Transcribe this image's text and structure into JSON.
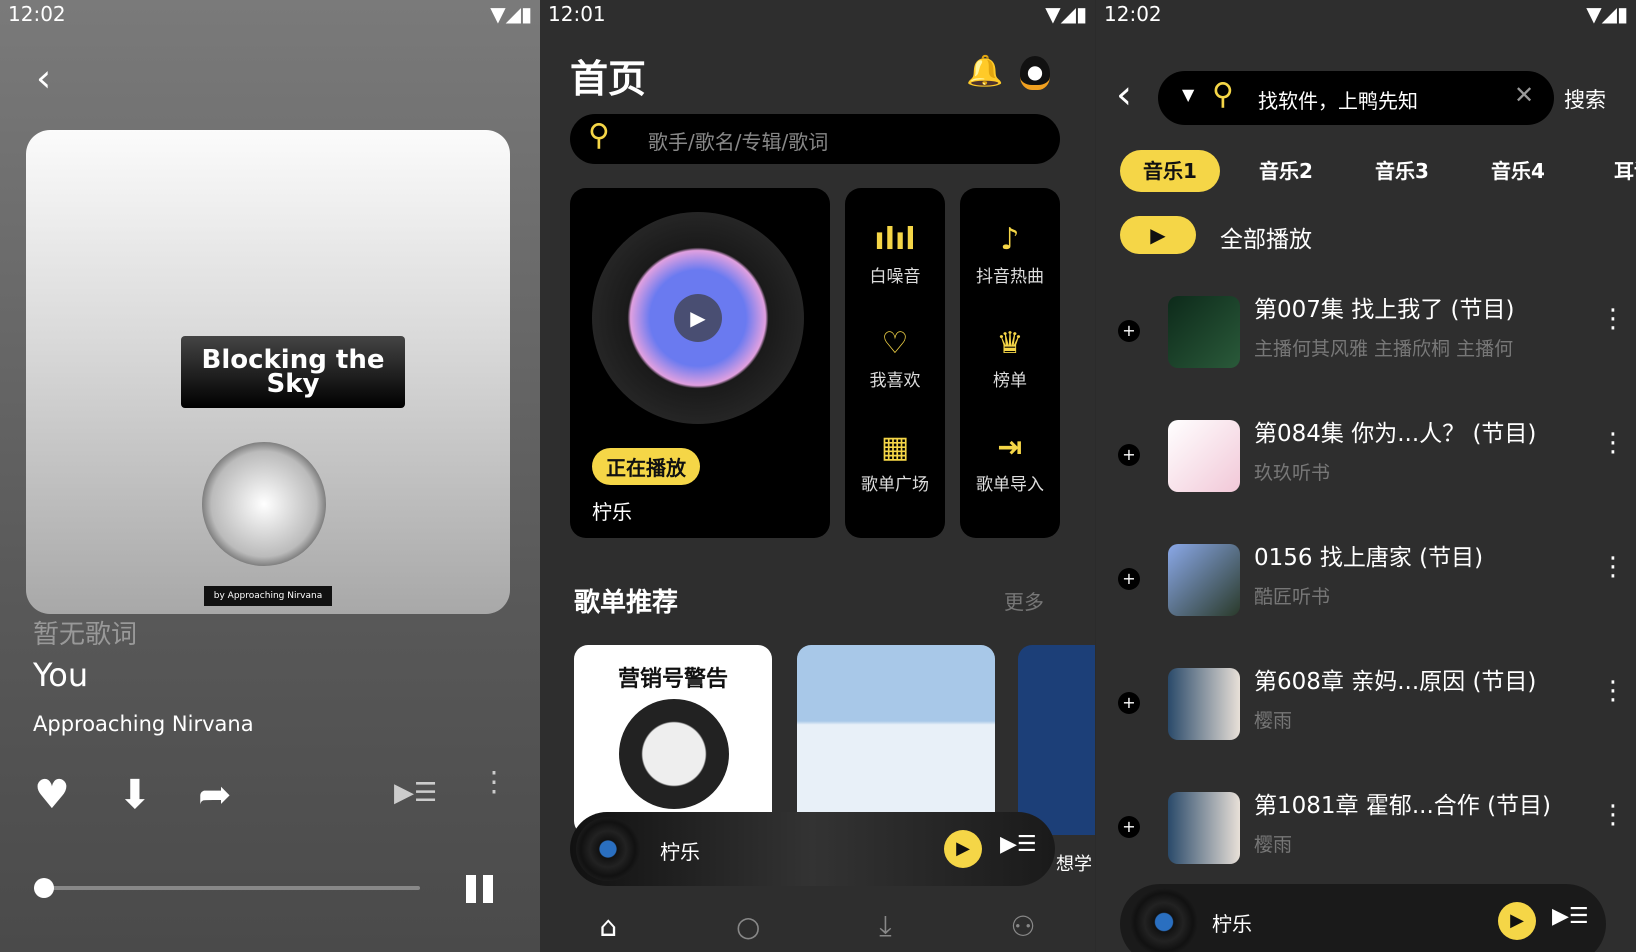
{
  "player": {
    "status_time": "12:02",
    "album_title": "Blocking the Sky",
    "album_credit": "by Approaching Nirvana",
    "lyrics": "暂无歌词",
    "song_title": "You",
    "artist": "Approaching Nirvana",
    "progress_percent": 0
  },
  "home": {
    "status_time": "12:01",
    "title": "首页",
    "search_placeholder": "歌手/歌名/专辑/歌词",
    "now_playing_badge": "正在播放",
    "now_playing_name": "柠乐",
    "shortcuts": [
      {
        "label": "白噪音",
        "icon": "sound-wave-icon"
      },
      {
        "label": "抖音热曲",
        "icon": "tiktok-icon"
      },
      {
        "label": "我喜欢",
        "icon": "heart-icon"
      },
      {
        "label": "榜单",
        "icon": "crown-icon"
      },
      {
        "label": "歌单广场",
        "icon": "grid-icon"
      },
      {
        "label": "歌单导入",
        "icon": "import-icon"
      }
    ],
    "section_title": "歌单推荐",
    "more_label": "更多",
    "playlist_cover_text": "营销号警告",
    "playlist_peek_text": "想学",
    "mini_player_name": "柠乐",
    "nav": [
      "home-icon",
      "search-icon",
      "download-icon",
      "profile-icon"
    ],
    "accent": "#f5d647"
  },
  "search": {
    "status_time": "12:02",
    "query": "找软件，上鸭先知",
    "search_button": "搜索",
    "tabs": [
      "音乐1",
      "音乐2",
      "音乐3",
      "音乐4",
      "耳语"
    ],
    "active_tab": 0,
    "play_all": "全部播放",
    "results": [
      {
        "title": "第007集 找上我了 (节目)",
        "subtitle": "主播何其风雅 主播欣桐 主播何"
      },
      {
        "title": "第084集 你为...人？ (节目)",
        "subtitle": "玖玖听书"
      },
      {
        "title": "0156 找上唐家 (节目)",
        "subtitle": "酷匠听书"
      },
      {
        "title": "第608章 亲妈...原因 (节目)",
        "subtitle": "樱雨"
      },
      {
        "title": "第1081章 霍郁...合作 (节目)",
        "subtitle": "樱雨"
      }
    ],
    "mini_player_name": "柠乐"
  }
}
